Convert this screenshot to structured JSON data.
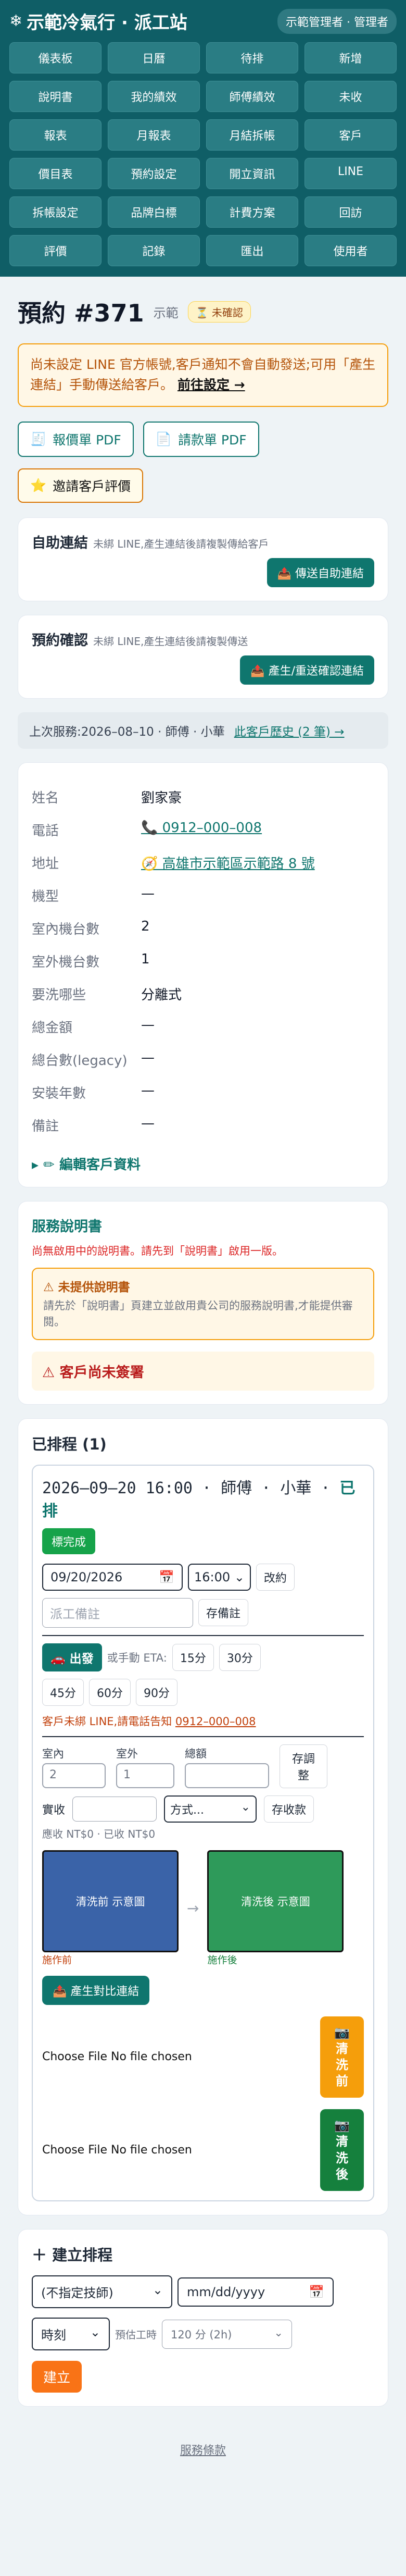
{
  "header": {
    "brand_icon": "❄",
    "brand": "示範冷氣行 · 派工站",
    "role": "示範管理者 · 管理者",
    "nav": [
      "儀表板",
      "日曆",
      "待排",
      "新增",
      "說明書",
      "我的績效",
      "師傅績效",
      "未收",
      "報表",
      "月報表",
      "月結拆帳",
      "客戶",
      "價目表",
      "預約設定",
      "開立資訊",
      "LINE",
      "拆帳設定",
      "品牌白標",
      "計費方案",
      "回訪",
      "評價",
      "記錄",
      "匯出",
      "使用者"
    ]
  },
  "booking": {
    "title": "預約 #371",
    "sub": "示範",
    "status": "⏳ 未確認"
  },
  "line_warning": {
    "text": "尚未設定 LINE 官方帳號,客戶通知不會自動發送;可用「產生連結」手動傳送給客戶。",
    "link": "前往設定 →"
  },
  "actions": {
    "quote_pdf": "報價單 PDF",
    "invoice_pdf": "請款單 PDF",
    "invite_review": "邀請客戶評價"
  },
  "auto_connect": {
    "label": "自助連結",
    "note": "未綁 LINE,產生連結後請複製傳給客戶",
    "button": "📤 傳送自助連結"
  },
  "booking_confirm": {
    "label": "預約確認",
    "note": "未綁 LINE,產生連結後請複製傳送",
    "button": "📤 產生/重送確認連結"
  },
  "last_service": {
    "text": "上次服務:2026–08–10 · 師傅 · 小華",
    "link": "此客戶歷史 (2 筆) →"
  },
  "customer": {
    "rows": [
      {
        "k": "姓名",
        "v": "劉家豪"
      },
      {
        "k": "電話",
        "v": "📞 0912–000–008"
      },
      {
        "k": "地址",
        "v": "🧭 高雄市示範區示範路 8 號"
      },
      {
        "k": "機型",
        "v": "—"
      },
      {
        "k": "室內機台數",
        "v": "2"
      },
      {
        "k": "室外機台數",
        "v": "1"
      },
      {
        "k": "要洗哪些",
        "v": "分離式"
      },
      {
        "k": "總金額",
        "v": "—"
      },
      {
        "k": "總台數(legacy)",
        "v": "—"
      },
      {
        "k": "安裝年數",
        "v": "—"
      },
      {
        "k": "備註",
        "v": "—"
      }
    ],
    "edit": "▸ ✏ 編輯客戶資料"
  },
  "manual": {
    "title": "服務說明書",
    "red_note": "尚無啟用中的說明書。請先到「說明書」啟用一版。",
    "warn_title": "⚠ 未提供說明書",
    "warn_body": "請先於「說明書」頁建立並啟用貴公司的服務說明書,才能提供審閱。",
    "unsigned": "⚠ 客戶尚未簽署"
  },
  "schedule": {
    "title": "已排程 (1)",
    "job_time": "2026–09–20 16:00",
    "job_tech": " · 師傅 · 小華 · ",
    "job_status": "已排",
    "done_btn": "標完成",
    "date": "09/20/2026",
    "time": "16:00",
    "reschedule": "改約",
    "note_placeholder": "派工備註",
    "save_note": "存備註",
    "depart": "🚗 出發",
    "eta_label": "或手動 ETA:",
    "eta": [
      "15分",
      "30分",
      "45分",
      "60分",
      "90分"
    ],
    "line_note": "客戶未綁 LINE,請電話告知",
    "line_phone": "0912–000–008",
    "cnt_labels": [
      "室內",
      "室外",
      "總額"
    ],
    "cnt_values": [
      "2",
      "1",
      ""
    ],
    "save_adjust": "存調整",
    "paid_label": "實收",
    "method": "方式...",
    "save_paid": "存收款",
    "due": "應收 NT$0 · 已收 NT$0",
    "photo_before": "清洗前 示意圖",
    "photo_after": "清洗後 示意圖",
    "label_before": "施作前",
    "label_after": "施作後",
    "compare": "📤 產生對比連結",
    "file1": "Choose File  No file chosen",
    "file2": "Choose File  No file chosen",
    "upload_before": "📷\n清\n洗\n前",
    "upload_after": "📷\n清\n洗\n後"
  },
  "create": {
    "title": "建立排程",
    "tech": "(不指定技師)",
    "date": "mm/dd/yyyy",
    "slot": "時刻",
    "est_label": "預估工時",
    "est": "120 分 (2h)",
    "submit": "建立"
  },
  "footer": {
    "terms": "服務條款"
  }
}
